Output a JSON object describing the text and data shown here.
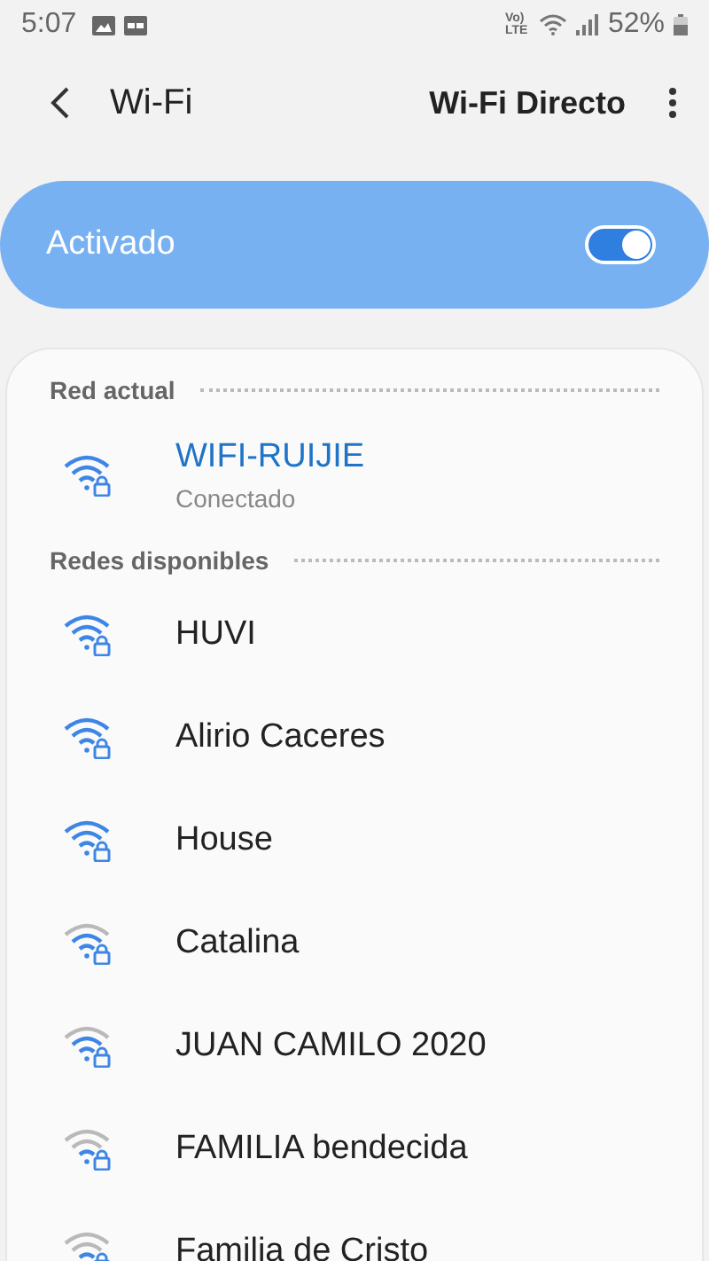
{
  "status_bar": {
    "time": "5:07",
    "network_label": "Vo) LTE",
    "battery": "52%"
  },
  "toolbar": {
    "title": "Wi-Fi",
    "action": "Wi-Fi Directo"
  },
  "master_switch": {
    "label": "Activado",
    "on": true
  },
  "current": {
    "header": "Red actual",
    "network": {
      "name": "WIFI-RUIJIE",
      "status": "Conectado",
      "kind": "full"
    }
  },
  "available": {
    "header": "Redes disponibles",
    "networks": [
      {
        "name": "HUVI",
        "kind": "full"
      },
      {
        "name": "Alirio Caceres",
        "kind": "full"
      },
      {
        "name": "House",
        "kind": "full"
      },
      {
        "name": "Catalina",
        "kind": "good"
      },
      {
        "name": "JUAN CAMILO 2020",
        "kind": "good"
      },
      {
        "name": "FAMILIA bendecida",
        "kind": "fair"
      },
      {
        "name": "Familia de Cristo",
        "kind": "fair"
      }
    ]
  }
}
